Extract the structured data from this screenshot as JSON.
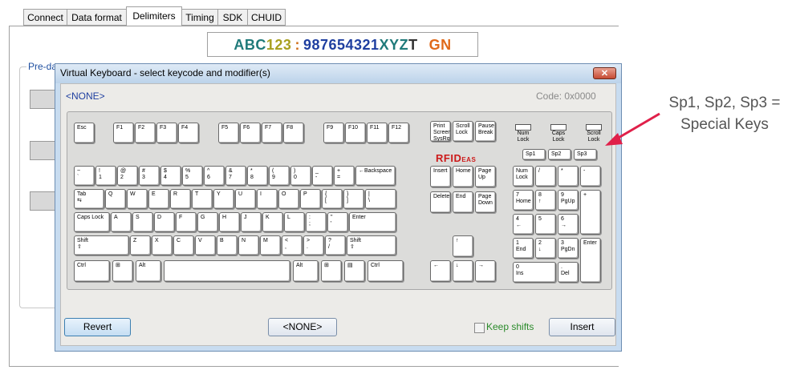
{
  "tabs": [
    "Connect",
    "Data format",
    "Delimiters",
    "Timing",
    "SDK",
    "CHUID"
  ],
  "active_tab": "Delimiters",
  "preview": {
    "segments": [
      {
        "text": "ABC",
        "color": "#1f7a7a"
      },
      {
        "text": "123",
        "color": "#a8a020"
      },
      {
        "text": ":",
        "color": "#d0701a"
      },
      {
        "text": "987654321",
        "color": "#1f3fa0"
      },
      {
        "text": "XYZ",
        "color": "#1f7a7a"
      },
      {
        "text": "T",
        "color": "#333333"
      },
      {
        "text": "GN",
        "color": "#e06a1a"
      }
    ]
  },
  "group_label": "Pre-da",
  "dialog": {
    "title": "Virtual Keyboard - select keycode and modifier(s)",
    "close_icon": "close-icon",
    "selected": "<NONE>",
    "code": "Code: 0x0000",
    "logo": {
      "main": "RFID",
      "sub": "EAS"
    },
    "function_row": [
      "Esc",
      "F1",
      "F2",
      "F3",
      "F4",
      "F5",
      "F6",
      "F7",
      "F8",
      "F9",
      "F10",
      "F11",
      "F12"
    ],
    "system_keys": [
      "Print\nScreen\nSysRq",
      "Scroll\nLock",
      "Pause\nBreak"
    ],
    "leds": [
      "Num\nLock",
      "Caps\nLock",
      "Scroll\nLock"
    ],
    "special_keys": [
      "Sp1",
      "Sp2",
      "Sp3"
    ],
    "row_numbers": [
      "~\n`",
      "!\n1",
      "@\n2",
      "#\n3",
      "$\n4",
      "%\n5",
      "^\n6",
      "&\n7",
      "*\n8",
      "(\n9",
      ")\n0",
      "_\n-",
      "+\n=",
      "←Backspace"
    ],
    "row_qwerty": [
      "Tab\n⇆",
      "Q",
      "W",
      "E",
      "R",
      "T",
      "Y",
      "U",
      "I",
      "O",
      "P",
      "{\n[",
      "}\n]",
      "|\n\\"
    ],
    "row_home": [
      "Caps Lock",
      "A",
      "S",
      "D",
      "F",
      "G",
      "H",
      "J",
      "K",
      "L",
      ":\n;",
      "\"\n'",
      "Enter"
    ],
    "row_shift": [
      "Shift\n⇧",
      "Z",
      "X",
      "C",
      "V",
      "B",
      "N",
      "M",
      "<\n,",
      ">\n.",
      "?\n/",
      "Shift\n⇧"
    ],
    "row_bottom": [
      "Ctrl",
      "⊞",
      "Alt",
      "",
      "Alt",
      "⊞",
      "▤",
      "Ctrl"
    ],
    "nav_keys": [
      "Insert",
      "Home",
      "Page\nUp",
      "Delete",
      "End",
      "Page\nDown"
    ],
    "arrow_keys": [
      "↑",
      "←",
      "↓",
      "→"
    ],
    "numpad": {
      "row1": [
        "Num\nLock",
        "/",
        "*",
        "-"
      ],
      "row2": [
        "7\nHome",
        "8\n↑",
        "9\nPgUp"
      ],
      "plus": "+",
      "row3": [
        "4\n←",
        "5",
        "6\n→"
      ],
      "row4": [
        "1\nEnd",
        "2\n↓",
        "3\nPgDn"
      ],
      "enter": "Enter",
      "row5": [
        "0\nIns",
        ".\nDel"
      ]
    },
    "buttons": {
      "revert": "Revert",
      "none": "<NONE>",
      "keep_shifts": "Keep shifts",
      "insert": "Insert"
    }
  },
  "annotation": {
    "line1": "Sp1, Sp2, Sp3 =",
    "line2": "Special Keys",
    "arrow_color": "#e0204a"
  }
}
